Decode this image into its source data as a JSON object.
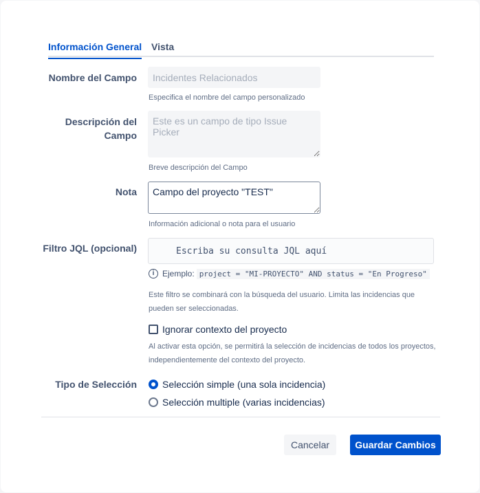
{
  "tabs": [
    {
      "label": "Información General",
      "active": true
    },
    {
      "label": "Vista",
      "active": false
    }
  ],
  "fields": {
    "name": {
      "label": "Nombre del Campo",
      "placeholder": "Incidentes Relacionados",
      "value": "",
      "help": "Especifica el nombre del campo personalizado"
    },
    "description": {
      "label_line1": "Descripción del",
      "label_line2": "Campo",
      "placeholder": "Este es un campo de tipo Issue Picker",
      "value": "",
      "help": "Breve descripción del Campo"
    },
    "note": {
      "label": "Nota",
      "value": "Campo del proyecto \"TEST\"",
      "help": "Información adicional o nota para el usuario"
    },
    "jql": {
      "label": "Filtro JQL (opcional)",
      "placeholder": "Escriba su consulta JQL aquí",
      "example_prefix": "Ejemplo:",
      "example_code": "project = \"MI-PROYECTO\" AND status = \"En Progreso\"",
      "help_line1": "Este filtro se combinará con la búsqueda del usuario. Limita las incidencias que",
      "help_line2": "pueden ser seleccionadas."
    },
    "ignore_context": {
      "label": "Ignorar contexto del proyecto",
      "checked": false,
      "help_line1": "Al activar esta opción, se permitirá la selección de incidencias de todos los proyectos,",
      "help_line2": "independientemente del contexto del proyecto."
    },
    "selection_type": {
      "label": "Tipo de Selección",
      "options": [
        {
          "label": "Selección simple (una sola incidencia)",
          "checked": true
        },
        {
          "label": "Selección multiple (varias incidencias)",
          "checked": false
        }
      ]
    }
  },
  "buttons": {
    "cancel": "Cancelar",
    "save": "Guardar Cambios"
  },
  "colors": {
    "primary": "#0052cc",
    "text": "#172b4d",
    "subtle": "#42526e"
  }
}
